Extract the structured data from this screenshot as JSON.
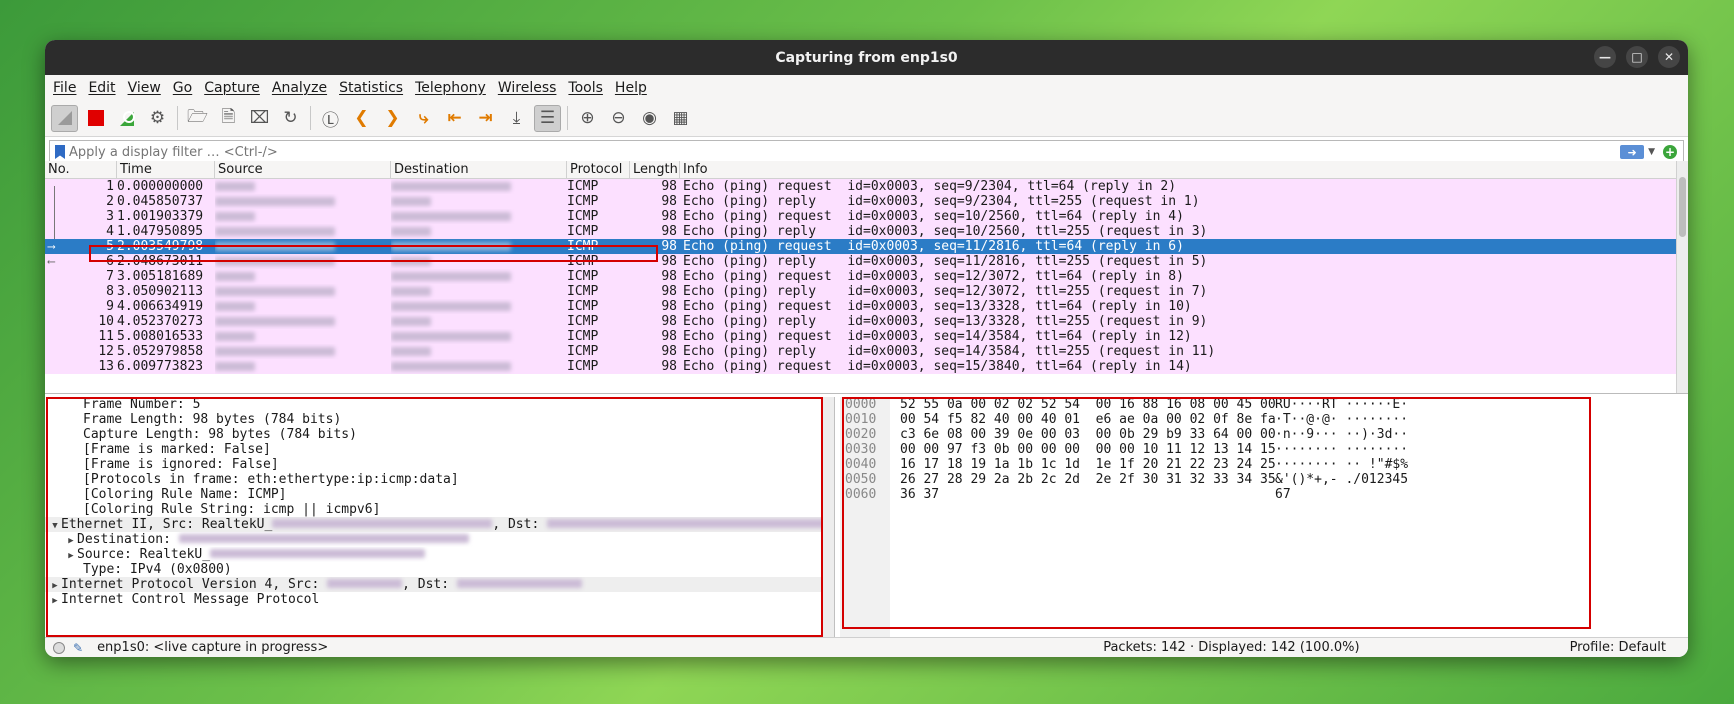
{
  "window": {
    "title": "Capturing from enp1s0"
  },
  "menu": [
    "File",
    "Edit",
    "View",
    "Go",
    "Capture",
    "Analyze",
    "Statistics",
    "Telephony",
    "Wireless",
    "Tools",
    "Help"
  ],
  "filter": {
    "placeholder": "Apply a display filter … <Ctrl-/>"
  },
  "columns": [
    "No.",
    "Time",
    "Source",
    "Destination",
    "Protocol",
    "Length",
    "Info"
  ],
  "packets": [
    {
      "no": "1",
      "time": "0.000000000",
      "proto": "ICMP",
      "len": "98",
      "info": "Echo (ping) request  id=0x0003, seq=9/2304, ttl=64 (reply in 2)"
    },
    {
      "no": "2",
      "time": "0.045850737",
      "proto": "ICMP",
      "len": "98",
      "info": "Echo (ping) reply    id=0x0003, seq=9/2304, ttl=255 (request in 1)"
    },
    {
      "no": "3",
      "time": "1.001903379",
      "proto": "ICMP",
      "len": "98",
      "info": "Echo (ping) request  id=0x0003, seq=10/2560, ttl=64 (reply in 4)"
    },
    {
      "no": "4",
      "time": "1.047950895",
      "proto": "ICMP",
      "len": "98",
      "info": "Echo (ping) reply    id=0x0003, seq=10/2560, ttl=255 (request in 3)"
    },
    {
      "no": "5",
      "time": "2.003549798",
      "proto": "ICMP",
      "len": "98",
      "info": "Echo (ping) request  id=0x0003, seq=11/2816, ttl=64 (reply in 6)"
    },
    {
      "no": "6",
      "time": "2.048673011",
      "proto": "ICMP",
      "len": "98",
      "info": "Echo (ping) reply    id=0x0003, seq=11/2816, ttl=255 (request in 5)"
    },
    {
      "no": "7",
      "time": "3.005181689",
      "proto": "ICMP",
      "len": "98",
      "info": "Echo (ping) request  id=0x0003, seq=12/3072, ttl=64 (reply in 8)"
    },
    {
      "no": "8",
      "time": "3.050902113",
      "proto": "ICMP",
      "len": "98",
      "info": "Echo (ping) reply    id=0x0003, seq=12/3072, ttl=255 (request in 7)"
    },
    {
      "no": "9",
      "time": "4.006634919",
      "proto": "ICMP",
      "len": "98",
      "info": "Echo (ping) request  id=0x0003, seq=13/3328, ttl=64 (reply in 10)"
    },
    {
      "no": "10",
      "time": "4.052370273",
      "proto": "ICMP",
      "len": "98",
      "info": "Echo (ping) reply    id=0x0003, seq=13/3328, ttl=255 (request in 9)"
    },
    {
      "no": "11",
      "time": "5.008016533",
      "proto": "ICMP",
      "len": "98",
      "info": "Echo (ping) request  id=0x0003, seq=14/3584, ttl=64 (reply in 12)"
    },
    {
      "no": "12",
      "time": "5.052979858",
      "proto": "ICMP",
      "len": "98",
      "info": "Echo (ping) reply    id=0x0003, seq=14/3584, ttl=255 (request in 11)"
    },
    {
      "no": "13",
      "time": "6.009773823",
      "proto": "ICMP",
      "len": "98",
      "info": "Echo (ping) request  id=0x0003, seq=15/3840, ttl=64 (reply in 14)"
    }
  ],
  "details": {
    "frame_number": "Frame Number: 5",
    "frame_length": "Frame Length: 98 bytes (784 bits)",
    "capture_length": "Capture Length: 98 bytes (784 bits)",
    "marked": "[Frame is marked: False]",
    "ignored": "[Frame is ignored: False]",
    "protocols": "[Protocols in frame: eth:ethertype:ip:icmp:data]",
    "rule_name": "[Coloring Rule Name: ICMP]",
    "rule_string": "[Coloring Rule String: icmp || icmpv6]",
    "ethernet_prefix": "Ethernet II, Src: RealtekU_",
    "ethernet_dst": ", Dst:",
    "destination": "Destination:",
    "source": "Source: RealtekU_",
    "type": "Type: IPv4 (0x0800)",
    "ipv4_prefix": "Internet Protocol Version 4, Src:",
    "ipv4_dst": ", Dst:",
    "icmp": "Internet Control Message Protocol"
  },
  "bytes": [
    {
      "off": "0000",
      "hex": "52 55 0a 00 02 02 52 54  00 16 88 16 08 00 45 00",
      "ascii": "RU····RT ······E·"
    },
    {
      "off": "0010",
      "hex": "00 54 f5 82 40 00 40 01  e6 ae 0a 00 02 0f 8e fa",
      "ascii": "·T··@·@· ········"
    },
    {
      "off": "0020",
      "hex": "c3 6e 08 00 39 0e 00 03  00 0b 29 b9 33 64 00 00",
      "ascii": "·n··9··· ··)·3d··"
    },
    {
      "off": "0030",
      "hex": "00 00 97 f3 0b 00 00 00  00 00 10 11 12 13 14 15",
      "ascii": "········ ········"
    },
    {
      "off": "0040",
      "hex": "16 17 18 19 1a 1b 1c 1d  1e 1f 20 21 22 23 24 25",
      "ascii": "········ ·· !\"#$%"
    },
    {
      "off": "0050",
      "hex": "26 27 28 29 2a 2b 2c 2d  2e 2f 30 31 32 33 34 35",
      "ascii": "&'()*+,- ./012345"
    },
    {
      "off": "0060",
      "hex": "36 37",
      "ascii": "67"
    }
  ],
  "status": {
    "capture": "enp1s0: <live capture in progress>",
    "packets": "Packets: 142 · Displayed: 142 (100.0%)",
    "profile": "Profile: Default"
  },
  "colors": {
    "icmp_row": "#fce0ff",
    "selected_row": "#2b7cc6",
    "highlight_box": "#d40000"
  }
}
